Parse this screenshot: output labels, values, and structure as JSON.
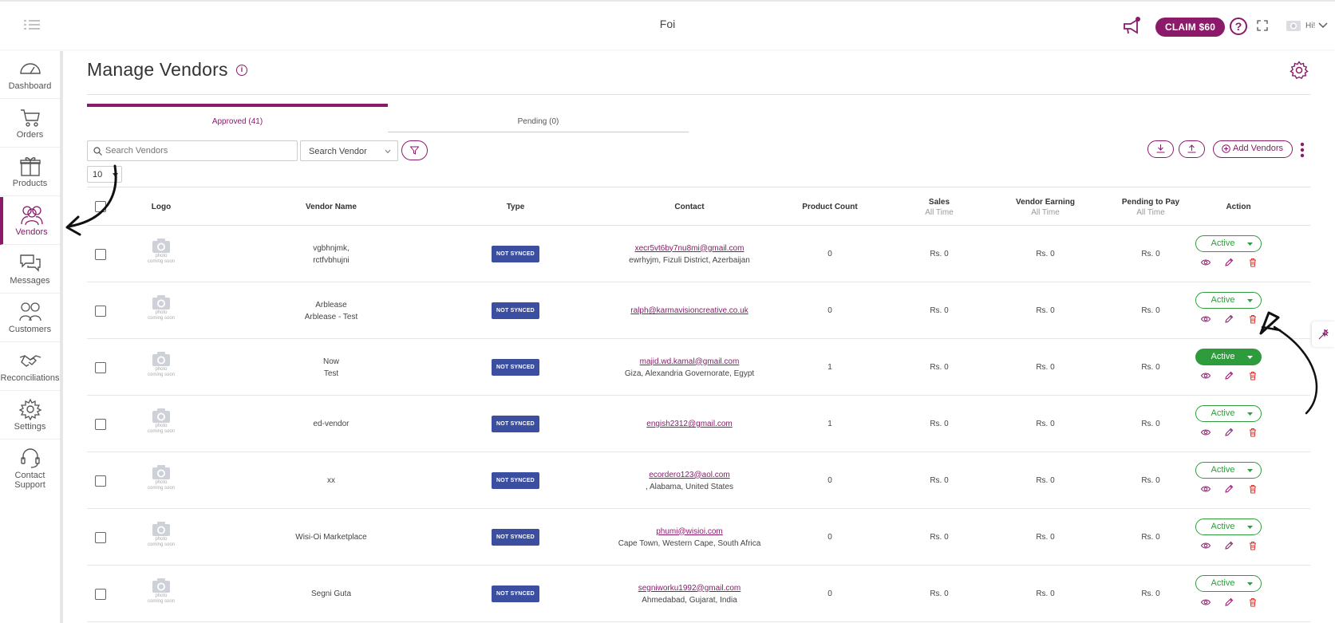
{
  "header": {
    "title": "Foi",
    "claim_label": "CLAIM $60",
    "help_label": "?",
    "greeting": "Hi!"
  },
  "sidebar": {
    "items": [
      {
        "label": "Dashboard",
        "icon": "speedometer-icon"
      },
      {
        "label": "Orders",
        "icon": "cart-icon"
      },
      {
        "label": "Products",
        "icon": "gift-icon"
      },
      {
        "label": "Vendors",
        "icon": "people-icon",
        "active": true
      },
      {
        "label": "Messages",
        "icon": "chat-icon"
      },
      {
        "label": "Customers",
        "icon": "customers-icon"
      },
      {
        "label": "Reconciliations",
        "icon": "handshake-icon"
      },
      {
        "label": "Settings",
        "icon": "gear-icon"
      },
      {
        "label": "Contact Support",
        "icon": "headset-icon"
      }
    ]
  },
  "page": {
    "title": "Manage Vendors",
    "tabs": [
      {
        "label": "Approved (41)",
        "active": true
      },
      {
        "label": "Pending (0)",
        "active": false
      }
    ],
    "search_placeholder": "Search Vendors",
    "search_select": "Search Vendor",
    "page_size": "10",
    "add_label": "Add Vendors"
  },
  "table": {
    "columns": {
      "logo": "Logo",
      "vendor_name": "Vendor Name",
      "type": "Type",
      "contact": "Contact",
      "product_count": "Product Count",
      "sales": "Sales",
      "sales_sub": "All Time",
      "vendor_earning": "Vendor Earning",
      "vendor_earning_sub": "All Time",
      "pending": "Pending to Pay",
      "pending_sub": "All Time",
      "action": "Action"
    },
    "placeholder_text": [
      "photo",
      "coming soon"
    ],
    "rows": [
      {
        "name1": "vgbhnjmk,",
        "name2": "rctfvbhujni",
        "type": "NOT SYNCED",
        "email": "xecr5vt6by7nu8mi@gmail.com",
        "location": "ewrhyjm, Fizuli District, Azerbaijan",
        "count": "0",
        "sales": "Rs. 0",
        "earning": "Rs. 0",
        "pending": "Rs. 0",
        "status": "Active",
        "filled": false
      },
      {
        "name1": "Arblease",
        "name2": "Arblease - Test",
        "type": "NOT SYNCED",
        "email": "ralph@karmavisioncreative.co.uk",
        "location": "",
        "count": "0",
        "sales": "Rs. 0",
        "earning": "Rs. 0",
        "pending": "Rs. 0",
        "status": "Active",
        "filled": false
      },
      {
        "name1": "Now",
        "name2": "Test",
        "type": "NOT SYNCED",
        "email": "majid.wd.kamal@gmail.com",
        "location": "Giza, Alexandria Governorate, Egypt",
        "count": "1",
        "sales": "Rs. 0",
        "earning": "Rs. 0",
        "pending": "Rs. 0",
        "status": "Active",
        "filled": true
      },
      {
        "name1": "ed-vendor",
        "name2": "",
        "type": "NOT SYNCED",
        "email": "engish2312@gmail.com",
        "location": "",
        "count": "1",
        "sales": "Rs. 0",
        "earning": "Rs. 0",
        "pending": "Rs. 0",
        "status": "Active",
        "filled": false
      },
      {
        "name1": "xx",
        "name2": "",
        "type": "NOT SYNCED",
        "email": "ecordero123@aol.com",
        "location": ", Alabama, United States",
        "count": "0",
        "sales": "Rs. 0",
        "earning": "Rs. 0",
        "pending": "Rs. 0",
        "status": "Active",
        "filled": false
      },
      {
        "name1": "Wisi-Oi Marketplace",
        "name2": "",
        "type": "NOT SYNCED",
        "email": "phumi@wisioi.com",
        "location": "Cape Town, Western Cape, South Africa",
        "count": "0",
        "sales": "Rs. 0",
        "earning": "Rs. 0",
        "pending": "Rs. 0",
        "status": "Active",
        "filled": false
      },
      {
        "name1": "Segni Guta",
        "name2": "",
        "type": "NOT SYNCED",
        "email": "segniworku1992@gmail.com",
        "location": "Ahmedabad, Gujarat, India",
        "count": "0",
        "sales": "Rs. 0",
        "earning": "Rs. 0",
        "pending": "Rs. 0",
        "status": "Active",
        "filled": false
      }
    ]
  },
  "colors": {
    "brand": "#8b1a6b",
    "active_green": "#2e9c3c",
    "badge_blue": "#3b4ea0",
    "delete_red": "#d9342b"
  }
}
